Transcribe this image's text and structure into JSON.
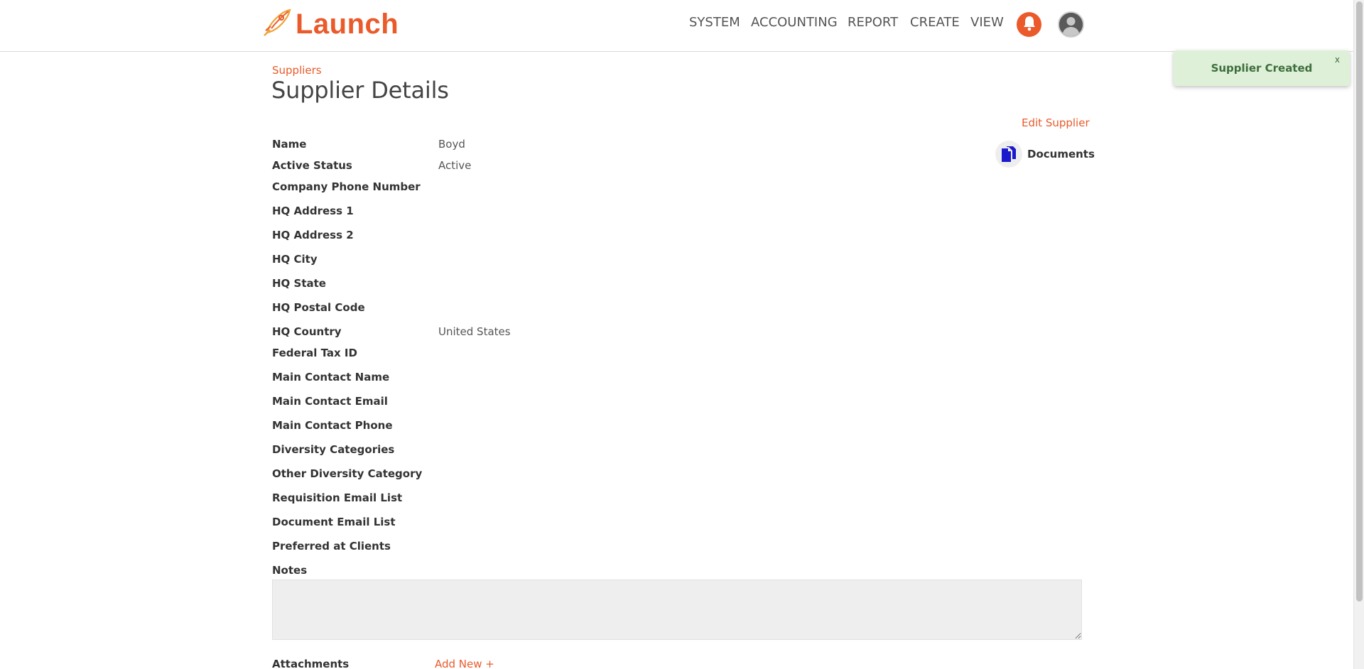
{
  "app": {
    "logo_text": "Launch"
  },
  "nav": {
    "items": [
      "SYSTEM",
      "ACCOUNTING",
      "REPORT",
      "CREATE",
      "VIEW"
    ],
    "bell_icon": "bell-icon",
    "avatar_icon": "user-avatar-icon"
  },
  "toast": {
    "message": "Supplier Created",
    "close": "x"
  },
  "breadcrumb": "Suppliers",
  "page_title": "Supplier Details",
  "actions": {
    "edit": "Edit Supplier",
    "documents": "Documents"
  },
  "fields": [
    {
      "label": "Name",
      "value": "Boyd"
    },
    {
      "label": "Active Status",
      "value": "Active"
    },
    {
      "label": "Company Phone Number",
      "value": ""
    },
    {
      "label": "HQ Address 1",
      "value": ""
    },
    {
      "label": "HQ Address 2",
      "value": ""
    },
    {
      "label": "HQ City",
      "value": ""
    },
    {
      "label": "HQ State",
      "value": ""
    },
    {
      "label": "HQ Postal Code",
      "value": ""
    },
    {
      "label": "HQ Country",
      "value": "United States"
    },
    {
      "label": "Federal Tax ID",
      "value": ""
    },
    {
      "label": "Main Contact Name",
      "value": ""
    },
    {
      "label": "Main Contact Email",
      "value": ""
    },
    {
      "label": "Main Contact Phone",
      "value": ""
    },
    {
      "label": "Diversity Categories",
      "value": ""
    },
    {
      "label": "Other Diversity Category",
      "value": ""
    },
    {
      "label": "Requisition Email List",
      "value": ""
    },
    {
      "label": "Document Email List",
      "value": ""
    },
    {
      "label": "Preferred at Clients",
      "value": ""
    },
    {
      "label": "Notes",
      "value": ""
    }
  ],
  "notes_value": "",
  "attachments": {
    "label": "Attachments",
    "add_new": "Add New +"
  },
  "colors": {
    "accent": "#ea5a2a",
    "toast_bg": "#dff0d8",
    "docs_icon": "#1a1acc"
  }
}
